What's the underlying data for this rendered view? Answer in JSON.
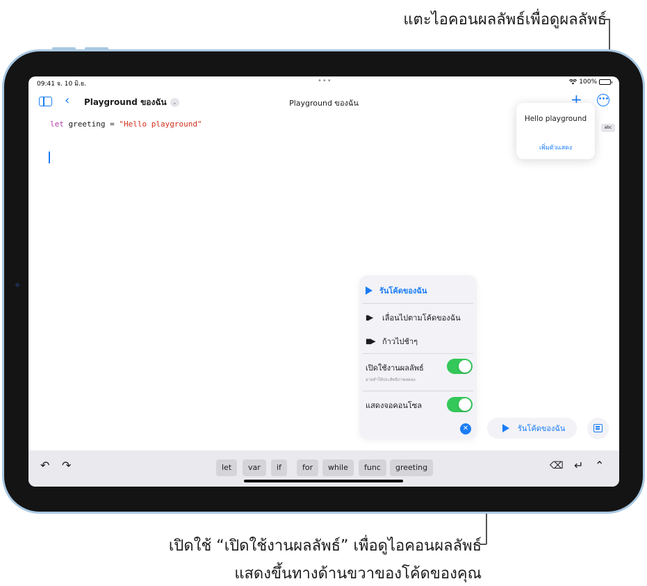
{
  "callouts": {
    "top": "แตะไอคอนผลลัพธ์เพื่อดูผลลัพธ์",
    "bottom_line1": "เปิดใช้ “เปิดใช้งานผลลัพธ์” เพื่อดูไอคอนผลลัพธ์",
    "bottom_line2": "แสดงขึ้นทางด้านขวาของโค้ดของคุณ"
  },
  "status_bar": {
    "time": "09:41 จ. 10 มิ.ย.",
    "dots": "•••",
    "battery": "100%"
  },
  "navbar": {
    "document_title": "Playground ของฉัน",
    "center_title": "Playground ของฉัน"
  },
  "editor": {
    "keyword": "let",
    "identifier": " greeting = ",
    "string_literal": "\"Hello playground\""
  },
  "result_badge": "abc",
  "result_popover": {
    "value": "Hello playground",
    "add_viewer": "เพิ่มตัวแสดง"
  },
  "run_menu": {
    "run": "รันโค้ดของฉัน",
    "step_through": "เลื่อนไปตามโค้ดของฉัน",
    "step_slowly": "ก้าวไปช้าๆ",
    "enable_results": "เปิดใช้งานผลลัพธ์",
    "enable_results_note": "อาจทำให้ประสิทธิภาพลดลง",
    "show_console": "แสดงจอคอนโซล",
    "enable_results_on": true,
    "show_console_on": true
  },
  "run_button": "รันโค้ดของฉัน",
  "shortcuts": [
    "let",
    "var",
    "if",
    "for",
    "while",
    "func",
    "greeting"
  ],
  "colors": {
    "accent": "#1a7cf5",
    "toggle_on": "#34c759",
    "keyword": "#ad3da4",
    "string": "#d12f1b",
    "device_frame": "#a9c8e2"
  }
}
